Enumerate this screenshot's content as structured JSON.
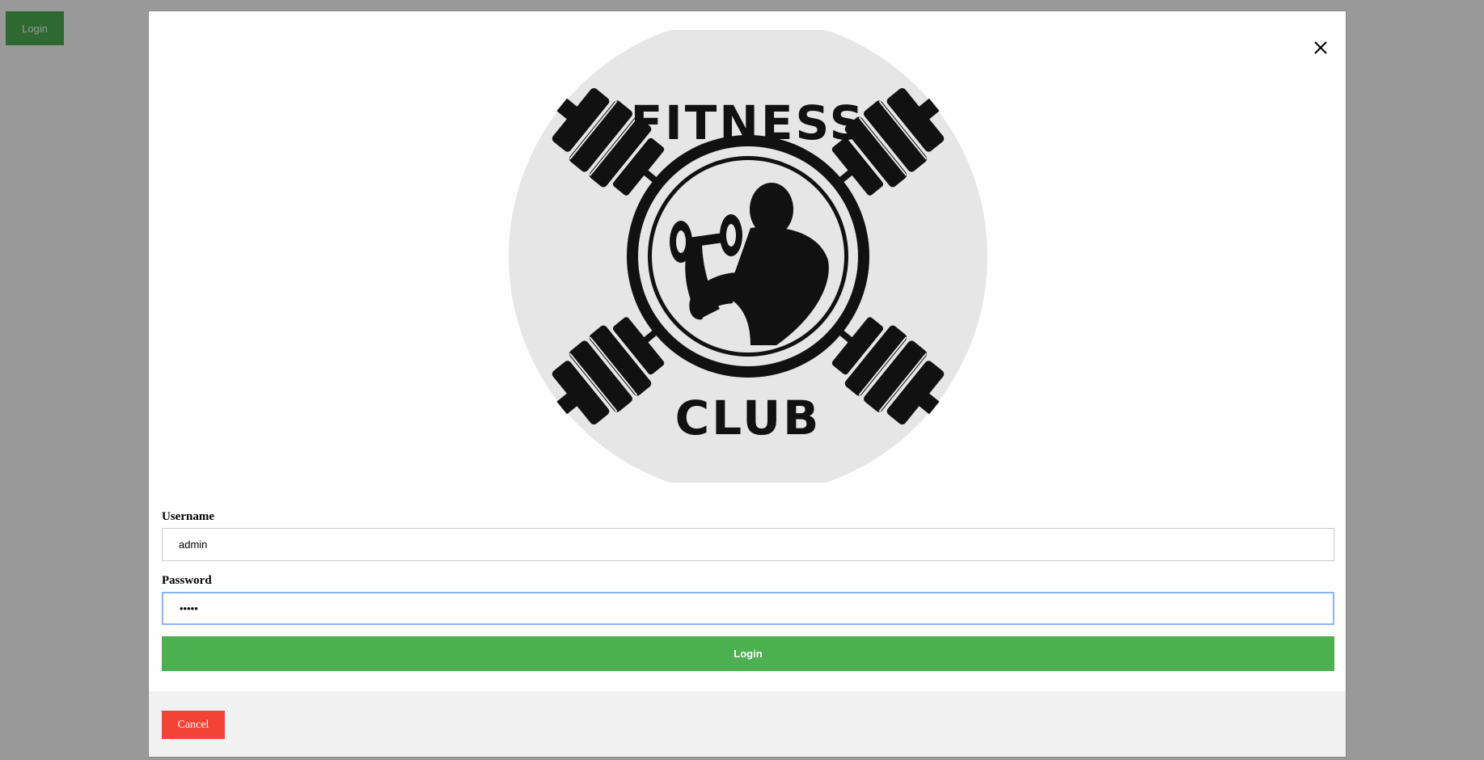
{
  "page": {
    "login_button_label": "Login"
  },
  "modal": {
    "logo": {
      "top_text": "FITNESS",
      "bottom_text": "CLUB"
    },
    "username": {
      "label": "Username",
      "value": "admin"
    },
    "password": {
      "label": "Password",
      "value": "•••••"
    },
    "submit_label": "Login",
    "cancel_label": "Cancel",
    "close_icon": "close-icon"
  },
  "colors": {
    "login_green": "#4caf50",
    "cancel_red": "#f44336",
    "logo_background": "#e6e6e6",
    "logo_ink": "#111111",
    "focus_border": "#8ab4f8"
  }
}
